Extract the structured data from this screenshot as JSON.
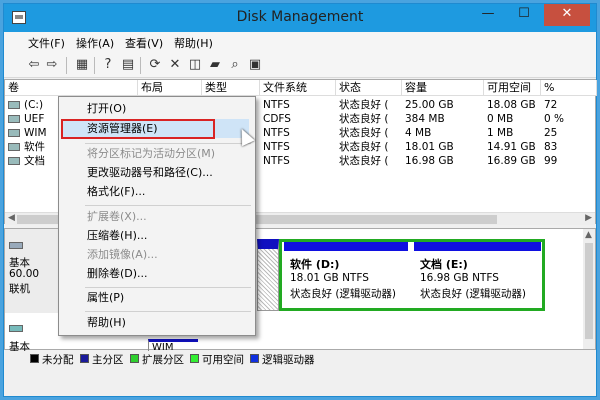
{
  "window": {
    "title": "Disk Management",
    "controls": {
      "minimize": "—",
      "maximize": "☐",
      "close": "✕"
    }
  },
  "menubar": {
    "items": [
      "文件(F)",
      "操作(A)",
      "查看(V)",
      "帮助(H)"
    ]
  },
  "toolbar": {
    "icons": [
      "back-arrow",
      "forward-arrow",
      "properties",
      "help",
      "view",
      "refresh",
      "delete",
      "rescan",
      "open",
      "search",
      "console"
    ]
  },
  "volume_list": {
    "columns": [
      "卷",
      "布局",
      "类型",
      "文件系统",
      "状态",
      "容量",
      "可用空间",
      "%"
    ],
    "rows": [
      {
        "vol": "(C:)",
        "layout": "",
        "type": "",
        "fs": "NTFS",
        "status": "状态良好 (",
        "capacity": "25.00 GB",
        "free": "18.08 GB",
        "pct": "72"
      },
      {
        "vol": "UEF",
        "layout": "",
        "type": "",
        "fs": "CDFS",
        "status": "状态良好 (",
        "capacity": "384 MB",
        "free": "0 MB",
        "pct": "0 %"
      },
      {
        "vol": "WIM",
        "layout": "",
        "type": "",
        "fs": "NTFS",
        "status": "状态良好 (",
        "capacity": "4 MB",
        "free": "1 MB",
        "pct": "25"
      },
      {
        "vol": "软件",
        "layout": "",
        "type": "",
        "fs": "NTFS",
        "status": "状态良好 (",
        "capacity": "18.01 GB",
        "free": "14.91 GB",
        "pct": "83"
      },
      {
        "vol": "文档",
        "layout": "",
        "type": "",
        "fs": "NTFS",
        "status": "状态良好 (",
        "capacity": "16.98 GB",
        "free": "16.89 GB",
        "pct": "99"
      }
    ]
  },
  "disk0": {
    "label": "基本",
    "size": "60.00",
    "state": "联机"
  },
  "partitions": [
    {
      "title": "软件  (D:)",
      "size_fs": "18.01 GB NTFS",
      "status": "状态良好 (逻辑驱动器)"
    },
    {
      "title": "文档  (E:)",
      "size_fs": "16.98 GB NTFS",
      "status": "状态良好 (逻辑驱动器)"
    }
  ],
  "disk1": {
    "label": "基本",
    "partition_label": "WIM"
  },
  "legend": [
    {
      "label": "未分配",
      "color": "#000000"
    },
    {
      "label": "主分区",
      "color": "#1a1a9a"
    },
    {
      "label": "扩展分区",
      "color": "#2fcf2f"
    },
    {
      "label": "可用空间",
      "color": "#33ee33"
    },
    {
      "label": "逻辑驱动器",
      "color": "#1030e0"
    }
  ],
  "context_menu": {
    "items": [
      {
        "label": "打开(O)",
        "enabled": true
      },
      {
        "label": "资源管理器(E)",
        "enabled": true,
        "highlighted": true
      },
      {
        "label": "将分区标记为活动分区(M)",
        "enabled": false
      },
      {
        "label": "更改驱动器号和路径(C)...",
        "enabled": true
      },
      {
        "label": "格式化(F)...",
        "enabled": true
      },
      {
        "label": "扩展卷(X)...",
        "enabled": false
      },
      {
        "label": "压缩卷(H)...",
        "enabled": true
      },
      {
        "label": "添加镜像(A)...",
        "enabled": false
      },
      {
        "label": "删除卷(D)...",
        "enabled": true
      },
      {
        "label": "属性(P)",
        "enabled": true
      },
      {
        "label": "帮助(H)",
        "enabled": true
      }
    ]
  }
}
